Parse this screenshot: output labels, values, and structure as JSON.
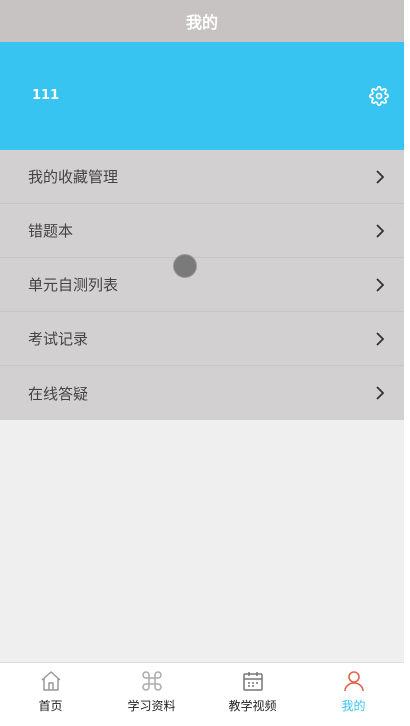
{
  "header": {
    "title": "我的"
  },
  "profile": {
    "name": "111"
  },
  "menu": {
    "items": [
      {
        "label": "我的收藏管理"
      },
      {
        "label": "错题本"
      },
      {
        "label": "单元自测列表"
      },
      {
        "label": "考试记录"
      },
      {
        "label": "在线答疑"
      }
    ]
  },
  "tabbar": {
    "active_index": 3,
    "active_color": "#38c4f1",
    "tabs": [
      {
        "label": "首页",
        "icon": "home-icon"
      },
      {
        "label": "学习资料",
        "icon": "command-icon"
      },
      {
        "label": "教学视频",
        "icon": "calendar-icon"
      },
      {
        "label": "我的",
        "icon": "person-icon"
      }
    ]
  },
  "colors": {
    "header_bg": "#c7c3c3",
    "banner_bg": "#38c4f1",
    "menu_bg": "#d2d0d0",
    "page_bg": "#efefef"
  }
}
